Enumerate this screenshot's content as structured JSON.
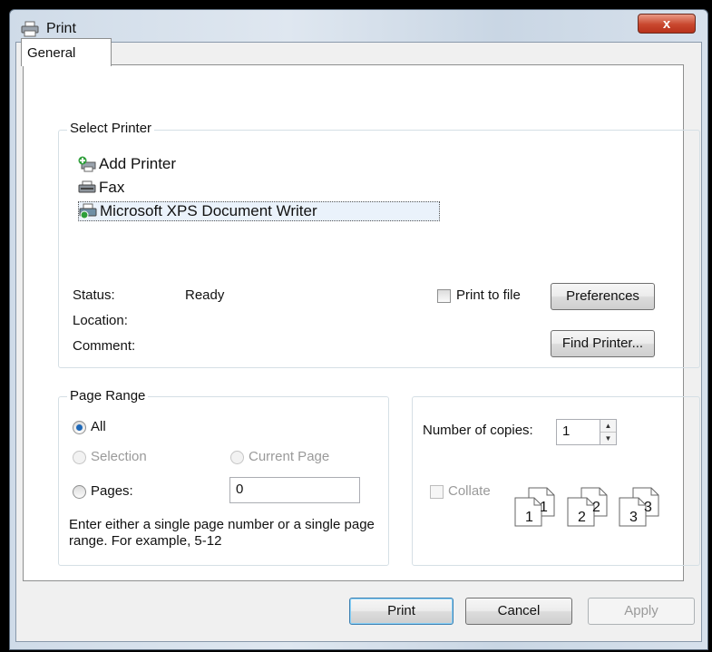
{
  "window": {
    "title": "Print",
    "close_label": "x"
  },
  "tabs": [
    {
      "label": "General"
    }
  ],
  "select_printer": {
    "group_label": "Select Printer",
    "printers": [
      {
        "name": "Add Printer",
        "icon": "add-printer-icon"
      },
      {
        "name": "Fax",
        "icon": "fax-icon"
      },
      {
        "name": "Microsoft XPS Document Writer",
        "icon": "xps-printer-icon",
        "selected": true
      }
    ],
    "status_label": "Status:",
    "status_value": "Ready",
    "location_label": "Location:",
    "comment_label": "Comment:",
    "print_to_file_label": "Print to file",
    "preferences_label": "Preferences",
    "find_printer_label": "Find Printer..."
  },
  "page_range": {
    "group_label": "Page Range",
    "all_label": "All",
    "selection_label": "Selection",
    "current_page_label": "Current Page",
    "pages_label": "Pages:",
    "pages_value": "0",
    "hint": "Enter either a single page number or a single page range.  For example, 5-12"
  },
  "copies": {
    "number_label": "Number of copies:",
    "number_value": "1",
    "collate_label": "Collate",
    "collate_pages": [
      "1",
      "1",
      "2",
      "2",
      "3",
      "3"
    ]
  },
  "buttons": {
    "print": "Print",
    "cancel": "Cancel",
    "apply": "Apply"
  },
  "colors": {
    "accent": "#1e68b8",
    "close": "#c9472e",
    "selection": "#eaf2fb"
  }
}
